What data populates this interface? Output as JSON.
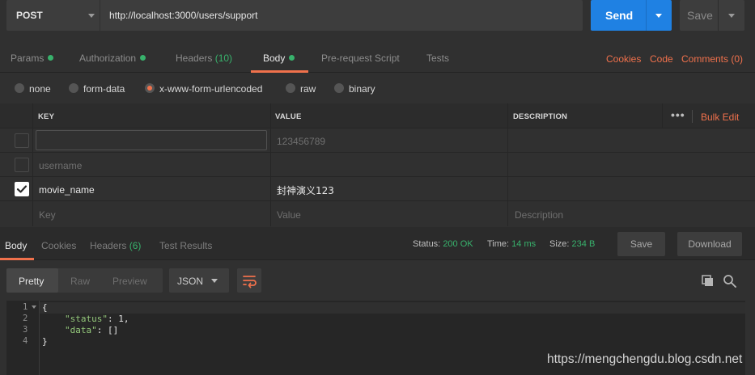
{
  "request": {
    "method": "POST",
    "url": "http://localhost:3000/users/support",
    "send_label": "Send",
    "save_label": "Save"
  },
  "tabs": [
    {
      "label": "Params",
      "dot": true
    },
    {
      "label": "Authorization",
      "dot": true
    },
    {
      "label": "Headers",
      "count": "(10)"
    },
    {
      "label": "Body",
      "dot": true,
      "active": true
    },
    {
      "label": "Pre-request Script"
    },
    {
      "label": "Tests"
    }
  ],
  "right_links": [
    "Cookies",
    "Code",
    "Comments (0)"
  ],
  "body_types": [
    {
      "label": "none",
      "selected": false
    },
    {
      "label": "form-data",
      "selected": false
    },
    {
      "label": "x-www-form-urlencoded",
      "selected": true
    },
    {
      "label": "raw",
      "selected": false
    },
    {
      "label": "binary",
      "selected": false
    }
  ],
  "params_table": {
    "headers": {
      "key": "KEY",
      "value": "VALUE",
      "description": "DESCRIPTION"
    },
    "more_icon": "ellipsis-icon",
    "bulk_edit": "Bulk Edit",
    "rows": [
      {
        "checked": false,
        "key": "",
        "value": "123456789",
        "description": ""
      },
      {
        "checked": false,
        "key": "username",
        "value": "",
        "description": ""
      },
      {
        "checked": true,
        "key": "movie_name",
        "value": "封神演义123",
        "description": ""
      }
    ],
    "placeholder": {
      "key": "Key",
      "value": "Value",
      "description": "Description"
    }
  },
  "response": {
    "tabs": [
      {
        "label": "Body",
        "active": true
      },
      {
        "label": "Cookies"
      },
      {
        "label": "Headers",
        "count": "(6)"
      },
      {
        "label": "Test Results"
      }
    ],
    "status_label": "Status:",
    "status": "200 OK",
    "time_label": "Time:",
    "time": "14 ms",
    "size_label": "Size:",
    "size": "234 B",
    "save_label": "Save",
    "download_label": "Download"
  },
  "viewer": {
    "modes": [
      "Pretty",
      "Raw",
      "Preview"
    ],
    "active_mode": "Pretty",
    "format": "JSON",
    "icons": [
      "wrap-lines-icon",
      "copy-icon",
      "search-icon"
    ]
  },
  "code": {
    "line_numbers": [
      "1",
      "2",
      "3",
      "4"
    ],
    "lines": {
      "l1": "{",
      "l2_key": "\"status\"",
      "l2_rest": ": 1,",
      "l3_key": "\"data\"",
      "l3_rest": ": []",
      "l4": "}"
    }
  },
  "watermark": "https://mengchengdu.blog.csdn.net"
}
